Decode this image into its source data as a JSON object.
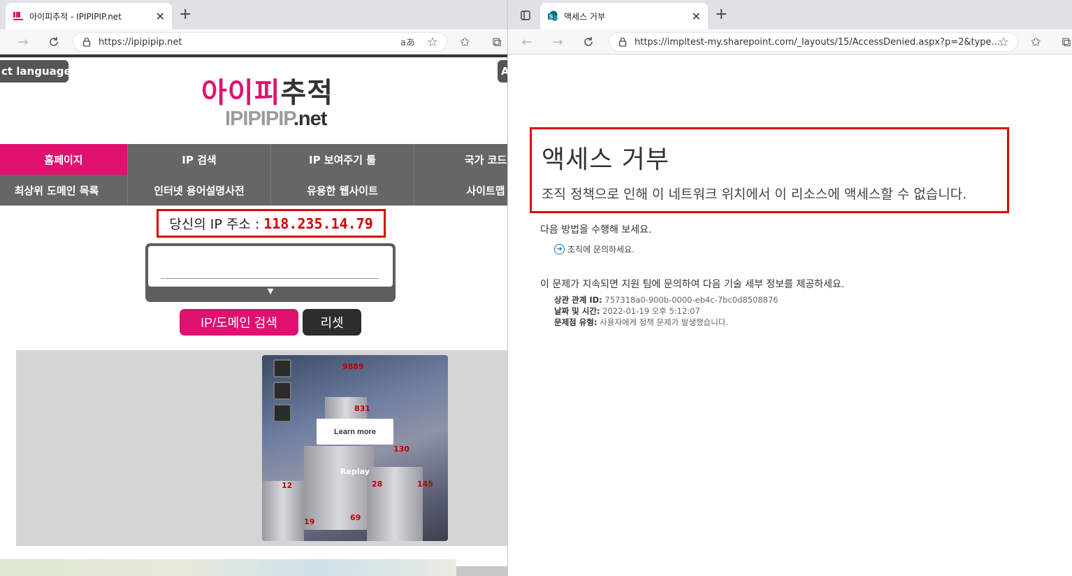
{
  "left_browser": {
    "tab_title": "아이피추적 - IPIPIPIP.net",
    "url": "https://ipipipip.net",
    "url_reader_glyph": "aあ"
  },
  "left_page": {
    "lang_button": "ct language",
    "lang_button_right": "A",
    "logo_pink": "아이피",
    "logo_dark": "추적",
    "logo_en_gray": "IPIPIPIP",
    "logo_en_dark": ".net",
    "nav_row1": [
      "홈페이지",
      "IP 검색",
      "IP 보여주기 툴",
      "국가 코드"
    ],
    "nav_row2": [
      "최상위 도메인 목록",
      "인터넷 용어설명사전",
      "유용한 웹사이트",
      "사이트맵"
    ],
    "ip_label": "당신의 IP 주소 :",
    "ip_value": "118.235.14.79",
    "search_value": "",
    "search_arrow": "▼",
    "search_button": "IP/도메인 검색",
    "reset_button": "리셋",
    "ad": {
      "learn_more": "Learn more",
      "replay": "Replay",
      "numbers": [
        "9889",
        "831",
        "130",
        "12",
        "28",
        "145",
        "19",
        "69"
      ]
    }
  },
  "right_browser": {
    "tab_title": "액세스 거부",
    "url": "https://impltest-my.sharepoint.com/_layouts/15/AccessDenied.aspx?p=2&type..."
  },
  "right_page": {
    "title": "액세스 거부",
    "message": "조직 정책으로 인해 이 네트워크 위치에서 이 리소스에 액세스할 수 없습니다.",
    "try_text": "다음 방법을 수행해 보세요.",
    "contact_text": "조직에 문의하세요.",
    "persist_text": "이 문제가 지속되면 지원 팀에 문의하여 다음 기술 세부 정보를 제공하세요.",
    "details": [
      {
        "label": "상관 관계 ID:",
        "value": "757318a0-900b-0000-eb4c-7bc0d8508876"
      },
      {
        "label": "날짜 및 시간:",
        "value": "2022-01-19 오후 5:12:07"
      },
      {
        "label": "문제점 유형:",
        "value": "사용자에게 정책 문제가 발생했습니다."
      }
    ]
  },
  "colors": {
    "brand_pink": "#e0106f",
    "highlight_red": "#e00000",
    "nav_gray": "#666666"
  }
}
